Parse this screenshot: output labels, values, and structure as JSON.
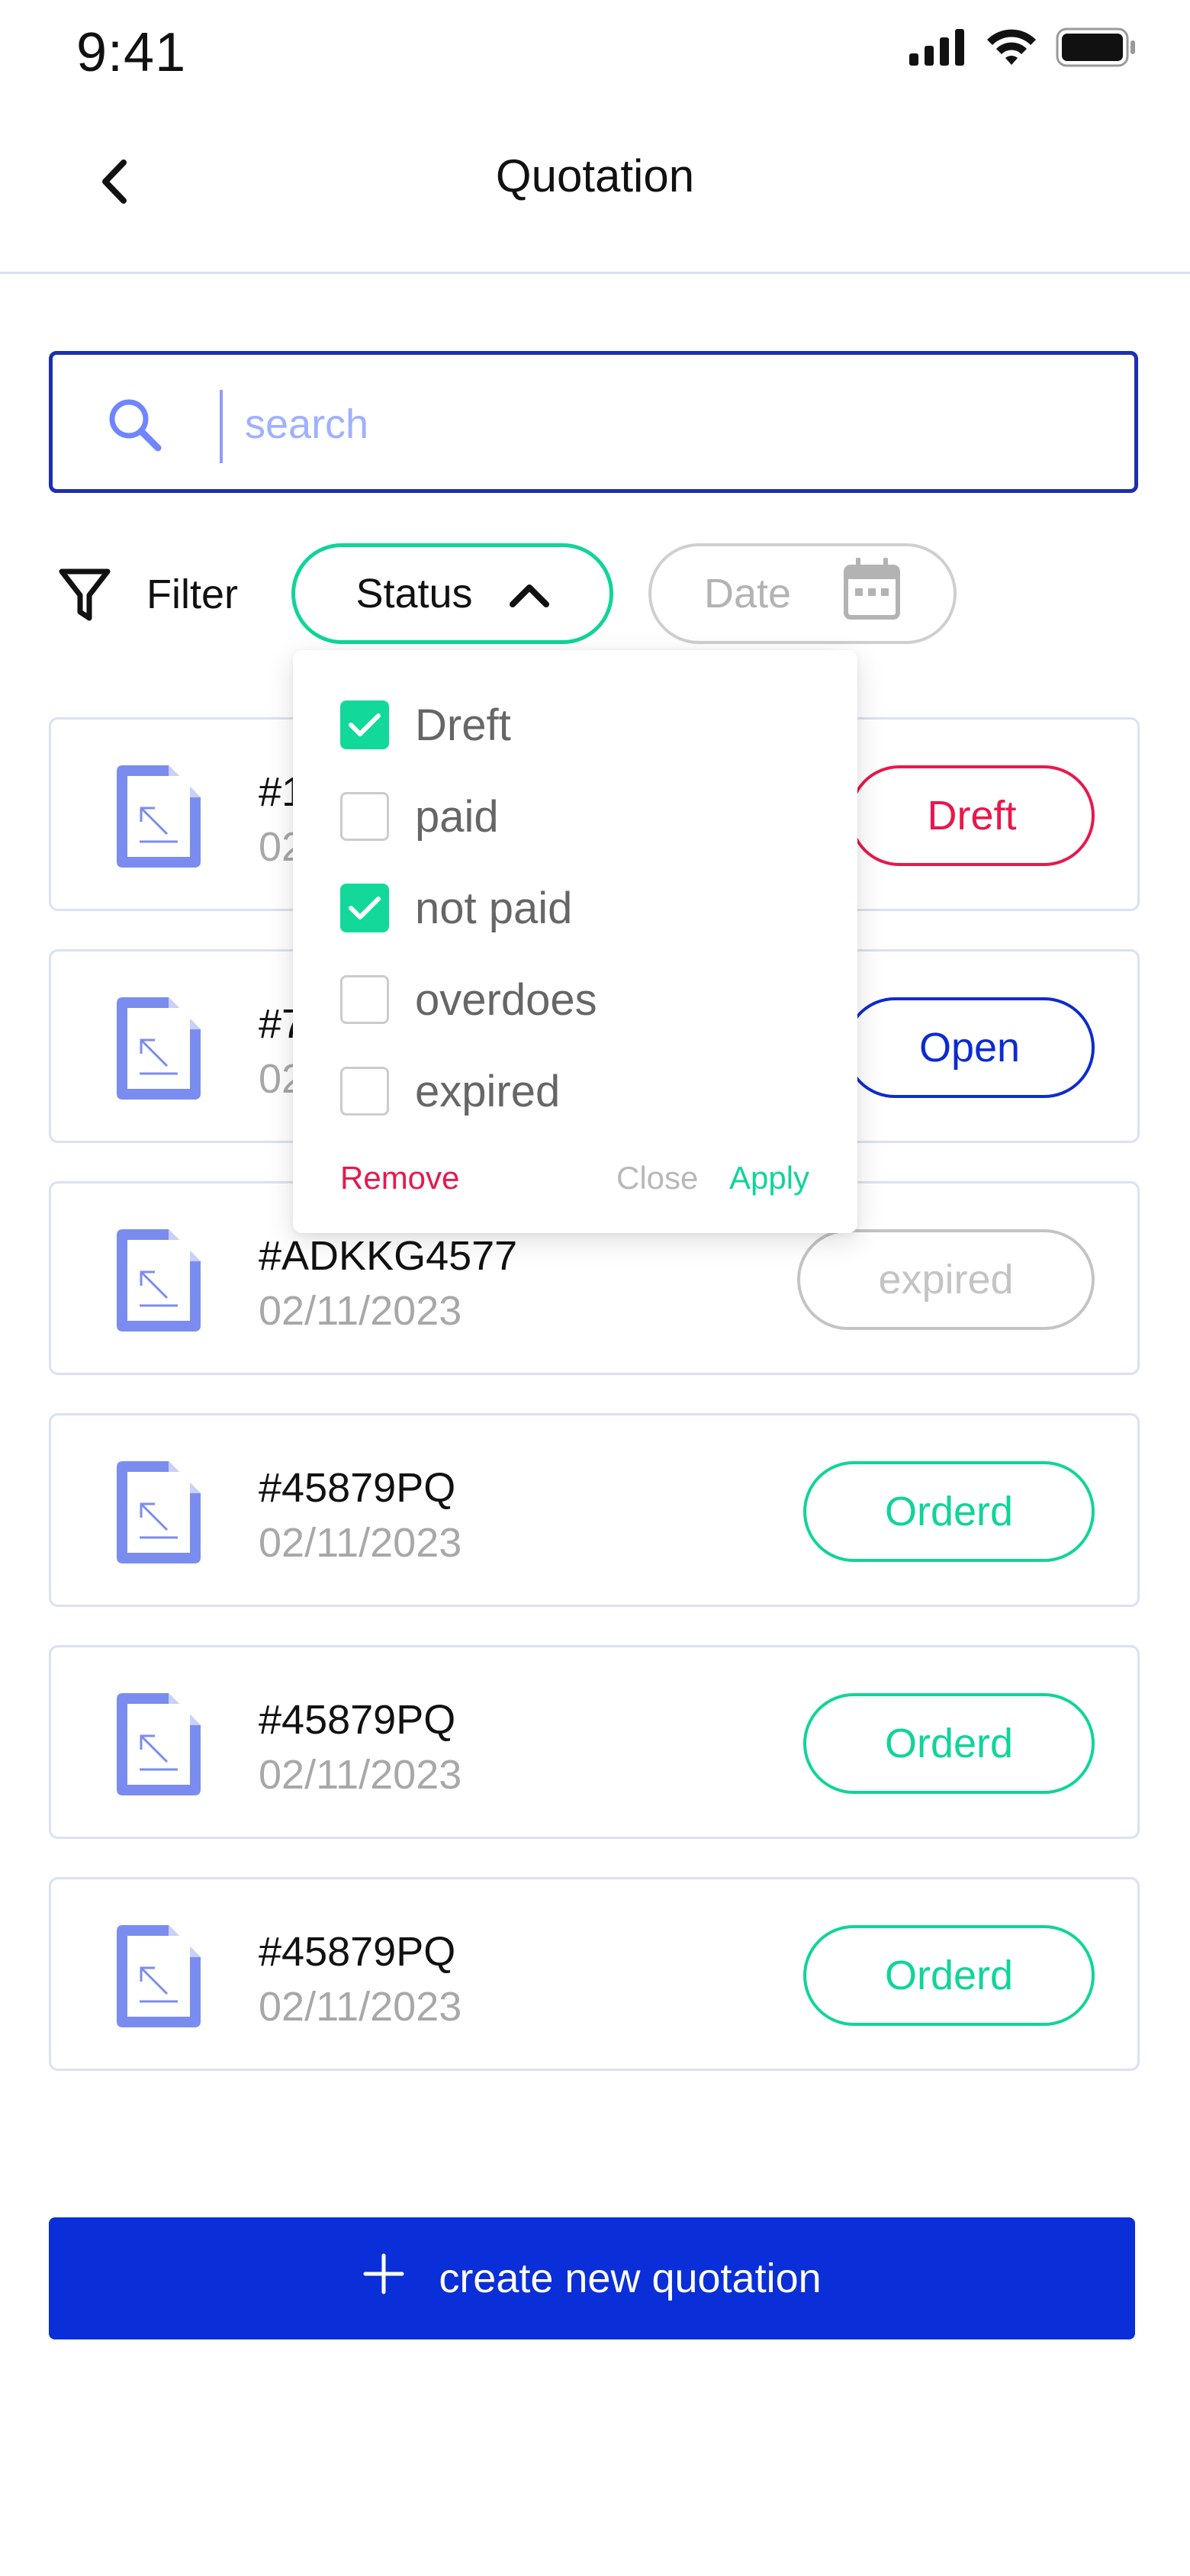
{
  "status_bar": {
    "time": "9:41",
    "icons": [
      "signal-icon",
      "wifi-icon",
      "battery-icon"
    ]
  },
  "header": {
    "title": "Quotation",
    "back_icon": "chevron-left-icon"
  },
  "search": {
    "placeholder": "search",
    "value": "",
    "icon": "search-icon"
  },
  "filter": {
    "label": "Filter",
    "icon": "filter-icon",
    "status_chip": {
      "label": "Status",
      "icon": "chevron-up-icon",
      "expanded": true
    },
    "date_chip": {
      "label": "Date",
      "icon": "calendar-icon"
    }
  },
  "status_dropdown": {
    "options": [
      {
        "label": "Dreft",
        "checked": true
      },
      {
        "label": "paid",
        "checked": false
      },
      {
        "label": "not paid",
        "checked": true
      },
      {
        "label": "overdoes",
        "checked": false
      },
      {
        "label": "expired",
        "checked": false
      }
    ],
    "remove_label": "Remove",
    "close_label": "Close",
    "apply_label": "Apply"
  },
  "quotations": [
    {
      "id": "#1",
      "date": "02",
      "status": "Dreft",
      "status_color": "#e8184c"
    },
    {
      "id": "#7",
      "date": "02",
      "status": "Open",
      "status_color": "#0d2bd1"
    },
    {
      "id": "#ADKKG4577",
      "date": "02/11/2023",
      "status": "expired",
      "status_color": "#c4c4c4"
    },
    {
      "id": "#45879PQ",
      "date": "02/11/2023",
      "status": "Orderd",
      "status_color": "#11d49a"
    },
    {
      "id": "#45879PQ",
      "date": "02/11/2023",
      "status": "Orderd",
      "status_color": "#11d49a"
    },
    {
      "id": "#45879PQ",
      "date": "02/11/2023",
      "status": "Orderd",
      "status_color": "#11d49a"
    }
  ],
  "create_button": {
    "label": "create new quotation",
    "icon": "plus-icon"
  },
  "colors": {
    "primary": "#0a2fd8",
    "accent_green": "#11d49a",
    "danger": "#e8184c",
    "doc_icon": "#7b8cf0",
    "border": "#dbe1f2"
  }
}
